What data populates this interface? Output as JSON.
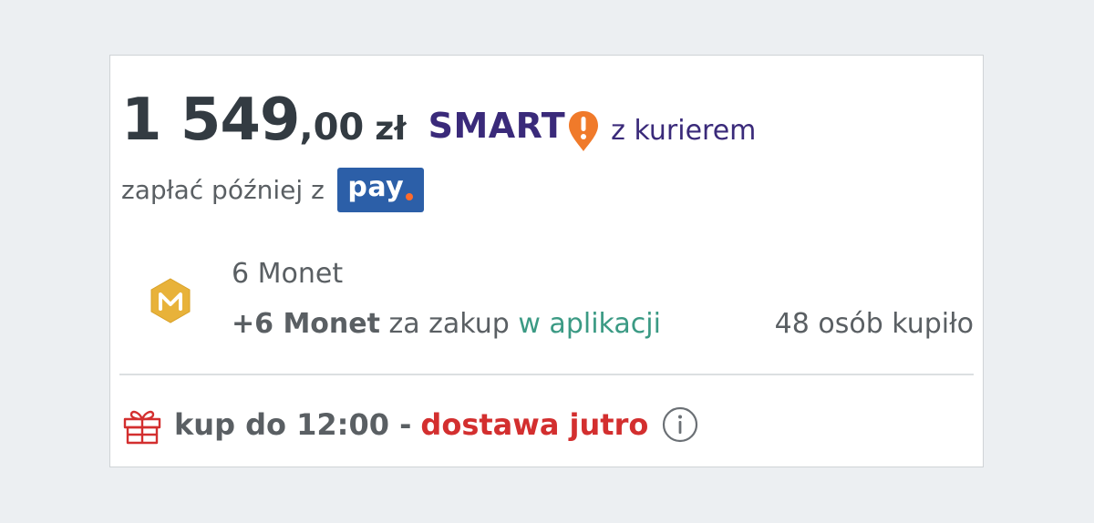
{
  "price": {
    "integer": "1 549",
    "decimal": ",00",
    "currency": "zł"
  },
  "smart": {
    "brand": "SMART",
    "icon": "smart-exclamation-pin-icon",
    "suffix": "z kurierem",
    "brand_color": "#3a2a7a",
    "icon_color": "#f07a2a"
  },
  "pay_later": {
    "text": "zapłać później z",
    "logo_text": "pay",
    "logo_color": "#2c5fa8"
  },
  "monety": {
    "icon": "monety-coin-icon",
    "title": "6 Monet",
    "bonus_bold": "+6 Monet",
    "bonus_text": " za zakup ",
    "bonus_link": "w aplikacji",
    "link_color": "#3b9a84"
  },
  "buyers": {
    "text": "48 osób kupiło"
  },
  "delivery": {
    "icon": "gift-icon",
    "prefix": "kup do 12:00 -",
    "highlight": "dostawa jutro",
    "highlight_color": "#d32f2f",
    "info_icon": "info-icon"
  }
}
